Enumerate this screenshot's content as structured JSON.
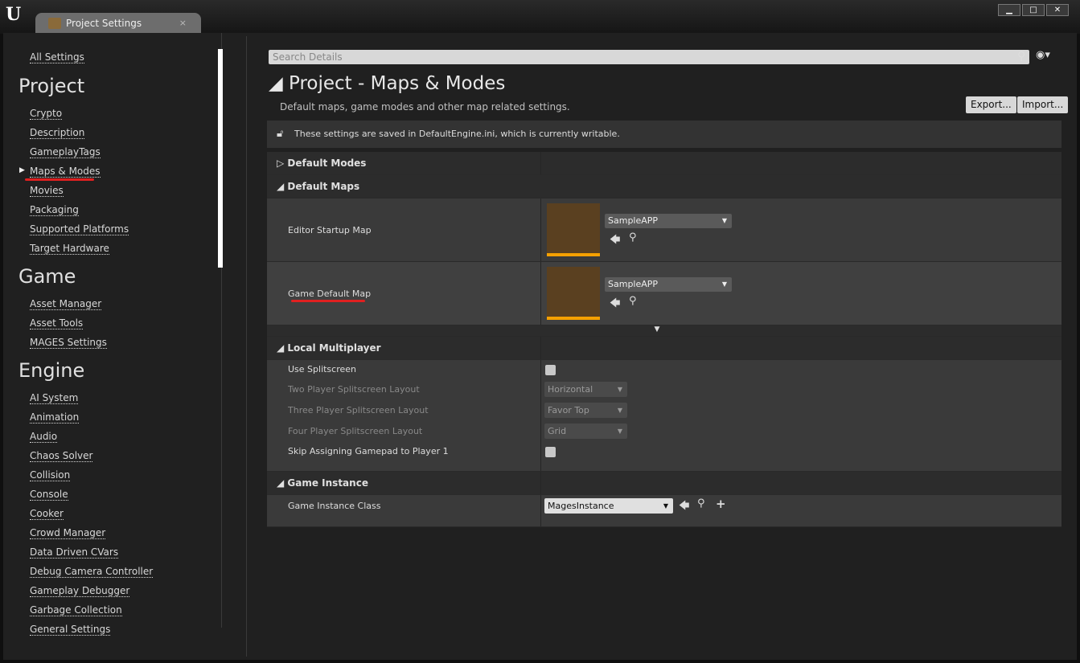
{
  "window": {
    "tab_title": "Project Settings",
    "close_tab": "×",
    "min": "▁",
    "max": "□",
    "close": "✕",
    "logo": "u"
  },
  "sidebar": {
    "all_settings": "All Settings",
    "categories": [
      {
        "title": "Project",
        "items": [
          "Crypto",
          "Description",
          "GameplayTags",
          "Maps & Modes",
          "Movies",
          "Packaging",
          "Supported Platforms",
          "Target Hardware"
        ]
      },
      {
        "title": "Game",
        "items": [
          "Asset Manager",
          "Asset Tools",
          "MAGES Settings"
        ]
      },
      {
        "title": "Engine",
        "items": [
          "AI System",
          "Animation",
          "Audio",
          "Chaos Solver",
          "Collision",
          "Console",
          "Cooker",
          "Crowd Manager",
          "Data Driven CVars",
          "Debug Camera Controller",
          "Gameplay Debugger",
          "Garbage Collection",
          "General Settings"
        ]
      }
    ],
    "selected": "Maps & Modes"
  },
  "search": {
    "placeholder": "Search Details"
  },
  "page": {
    "title": "Project - Maps & Modes",
    "subtitle": "Default maps, game modes and other map related settings.",
    "export": "Export...",
    "import": "Import...",
    "info": "These settings are saved in DefaultEngine.ini, which is currently writable."
  },
  "sections": {
    "default_modes": "Default Modes",
    "default_maps": {
      "title": "Default Maps",
      "editor_startup_map": {
        "label": "Editor Startup Map",
        "value": "SampleAPP"
      },
      "game_default_map": {
        "label": "Game Default Map",
        "value": "SampleAPP"
      }
    },
    "local_multiplayer": {
      "title": "Local Multiplayer",
      "use_splitscreen": {
        "label": "Use Splitscreen",
        "checked": false
      },
      "two_player": {
        "label": "Two Player Splitscreen Layout",
        "value": "Horizontal"
      },
      "three_player": {
        "label": "Three Player Splitscreen Layout",
        "value": "Favor Top"
      },
      "four_player": {
        "label": "Four Player Splitscreen Layout",
        "value": "Grid"
      },
      "skip_gamepad": {
        "label": "Skip Assigning Gamepad to Player 1",
        "checked": false
      }
    },
    "game_instance": {
      "title": "Game Instance",
      "class": {
        "label": "Game Instance Class",
        "value": "MagesInstance"
      }
    }
  },
  "colors": {
    "accent": "#f5a000",
    "annotation": "#e02020"
  }
}
